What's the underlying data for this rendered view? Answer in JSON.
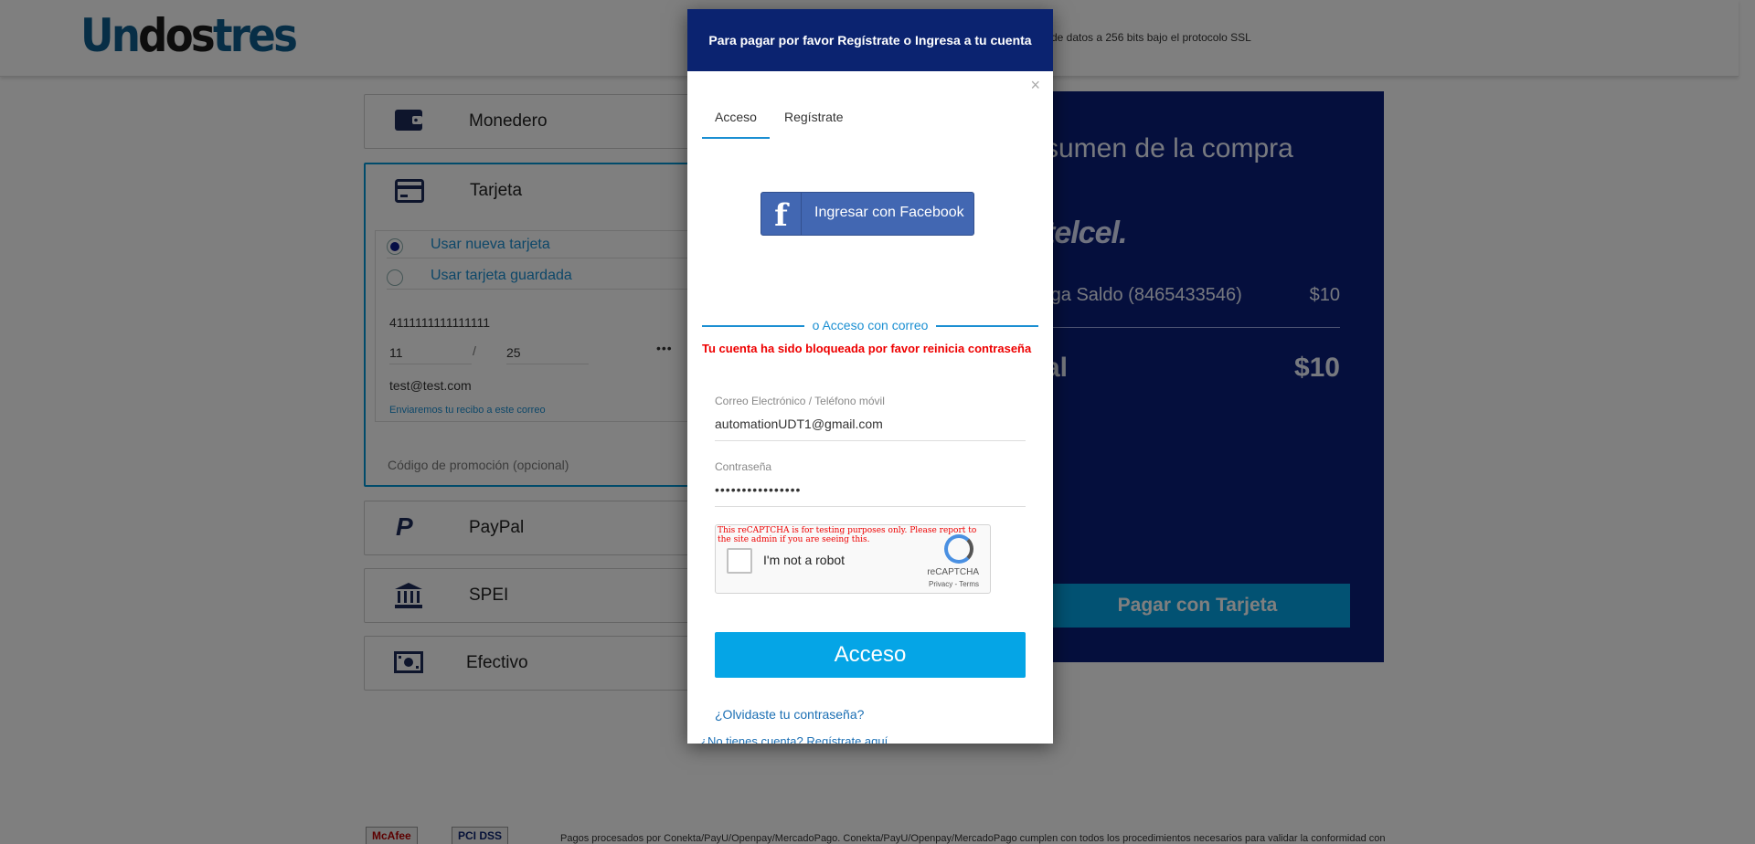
{
  "header": {
    "logo": {
      "part1": "Un",
      "part2": "dos",
      "part3": "tres"
    },
    "ssl_text": "de datos a 256 bits bajo el protocolo SSL"
  },
  "payment_methods": {
    "monedero": {
      "label": "Monedero",
      "icon": "wallet-icon"
    },
    "tarjeta": {
      "label": "Tarjeta",
      "icon": "credit-card-icon",
      "options": [
        {
          "label": "Usar nueva tarjeta",
          "selected": true
        },
        {
          "label": "Usar tarjeta guardada",
          "selected": false
        }
      ],
      "card_number": "4111111111111111",
      "exp_month": "11",
      "exp_separator": "/",
      "exp_year": "25",
      "cvv": "•••",
      "email": "test@test.com",
      "email_hint": "Enviaremos tu recibo a este correo",
      "promo_placeholder": "Código de promoción (opcional)"
    },
    "paypal": {
      "label": "PayPal",
      "icon": "paypal-icon"
    },
    "spei": {
      "label": "SPEI",
      "icon": "bank-icon"
    },
    "efectivo": {
      "label": "Efectivo",
      "icon": "cash-icon"
    }
  },
  "summary": {
    "title": "sumen de la compra",
    "carrier": "telcel.",
    "line_item": "rga Saldo (8465433546)",
    "line_price": "$10",
    "total_label": "al",
    "total_value": "$10",
    "pay_button": "Pagar con Tarjeta"
  },
  "footer": {
    "badge1": "McAfee",
    "badge2": "PCI DSS",
    "text": "Pagos procesados por Conekta/PayU/Openpay/MercadoPago. Conekta/PayU/Openpay/MercadoPago cumplen con todos los procedimientos necesarios para validar la conformidad con"
  },
  "modal": {
    "title": "Para pagar por favor Regístrate o Ingresa a tu cuenta",
    "close": "×",
    "tabs": [
      {
        "label": "Acceso",
        "active": true
      },
      {
        "label": "Regístrate",
        "active": false
      }
    ],
    "facebook_button": "Ingresar con Facebook",
    "facebook_glyph": "f",
    "divider_text": "o Acceso con correo",
    "error": "Tu cuenta ha sido bloqueada por favor reinicia contraseña",
    "email_label": "Correo Electrónico / Teléfono móvil",
    "email_value": "automationUDT1@gmail.com",
    "password_label": "Contraseña",
    "password_value": "••••••••••••••••",
    "recaptcha": {
      "warning": "This reCAPTCHA is for testing purposes only. Please report to the site admin if you are seeing this.",
      "label": "I'm not a robot",
      "brand": "reCAPTCHA",
      "terms": "Privacy - Terms"
    },
    "submit": "Acceso",
    "forgot": "¿Olvidaste tu contraseña?",
    "register": "¿No tienes cuenta? Regístrate aquí"
  },
  "colors": {
    "brand_blue": "#0f5d8c",
    "modal_header": "#0b2370",
    "summary_bg": "#0b1e7a",
    "accent": "#05a5e6",
    "error": "#ee0000"
  }
}
